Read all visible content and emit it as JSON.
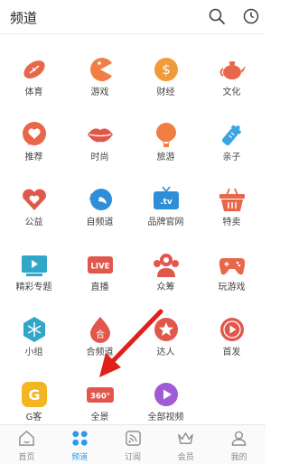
{
  "header": {
    "title": "频道"
  },
  "channels": [
    {
      "label": "体育",
      "icon": "football-icon",
      "color": "#e8664a"
    },
    {
      "label": "游戏",
      "icon": "pacman-icon",
      "color": "#f07e45"
    },
    {
      "label": "财经",
      "icon": "yuan-coin-icon",
      "color": "#f19a3a"
    },
    {
      "label": "文化",
      "icon": "teapot-icon",
      "color": "#e8664a"
    },
    {
      "label": "推荐",
      "icon": "heart-bubble-icon",
      "color": "#e8664a"
    },
    {
      "label": "时尚",
      "icon": "lips-icon",
      "color": "#e2574c"
    },
    {
      "label": "旅游",
      "icon": "hot-air-balloon-icon",
      "color": "#f07e45"
    },
    {
      "label": "亲子",
      "icon": "baby-bottle-icon",
      "color": "#3aa3e3"
    },
    {
      "label": "公益",
      "icon": "charity-heart-icon",
      "color": "#e2574c"
    },
    {
      "label": "自频道",
      "icon": "bird-icon",
      "color": "#2e8fd8"
    },
    {
      "label": "品牌官网",
      "icon": "tv-icon",
      "color": "#2e8fd8"
    },
    {
      "label": "特卖",
      "icon": "shopping-basket-icon",
      "color": "#e8664a"
    },
    {
      "label": "精彩专题",
      "icon": "play-screen-icon",
      "color": "#2ea7c9"
    },
    {
      "label": "直播",
      "icon": "live-icon",
      "color": "#e2574c"
    },
    {
      "label": "众筹",
      "icon": "crowdfunding-icon",
      "color": "#e2574c"
    },
    {
      "label": "玩游戏",
      "icon": "gamepad-icon",
      "color": "#e8664a"
    },
    {
      "label": "小组",
      "icon": "snowflake-icon",
      "color": "#2ea7c9"
    },
    {
      "label": "合频道",
      "icon": "he-channel-icon",
      "color": "#e2574c"
    },
    {
      "label": "达人",
      "icon": "star-badge-icon",
      "color": "#e2574c"
    },
    {
      "label": "首发",
      "icon": "play-circle-icon",
      "color": "#e2574c"
    },
    {
      "label": "G客",
      "icon": "g-logo-icon",
      "color": "#f3b520"
    },
    {
      "label": "全景",
      "icon": "panorama-360-icon",
      "color": "#e2574c"
    },
    {
      "label": "全部视频",
      "icon": "all-videos-play-icon",
      "color": "#a05bd6"
    }
  ],
  "icon_text": {
    "tv": ".tv",
    "live": "LIVE",
    "he": "合",
    "panorama": "360°",
    "coin": "$",
    "g": "G"
  },
  "tabs": [
    {
      "label": "首页",
      "icon": "home-icon",
      "active": false
    },
    {
      "label": "频道",
      "icon": "channel-grid-icon",
      "active": true
    },
    {
      "label": "订阅",
      "icon": "subscribe-signal-icon",
      "active": false
    },
    {
      "label": "会员",
      "icon": "crown-icon",
      "active": false
    },
    {
      "label": "我的",
      "icon": "user-icon",
      "active": false
    }
  ],
  "colors": {
    "accent": "#2b9ae8",
    "arrow": "#e0201b"
  }
}
